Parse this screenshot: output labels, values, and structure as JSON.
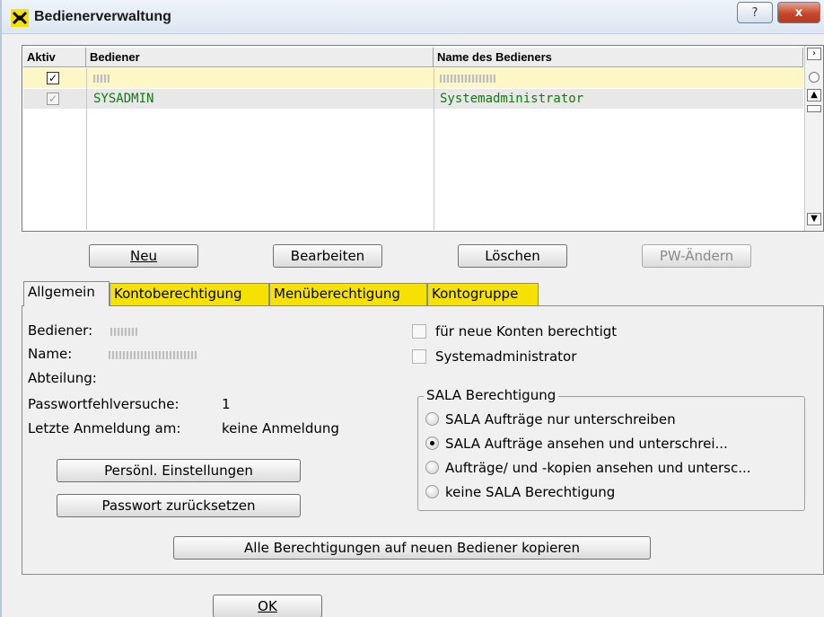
{
  "window": {
    "title": "Bedienerverwaltung",
    "help": "?",
    "close": "x"
  },
  "grid": {
    "columns": [
      "Aktiv",
      "Bediener",
      "Name des Bedieners"
    ],
    "rows": [
      {
        "aktiv": "✓",
        "bediener": "",
        "name": ""
      },
      {
        "aktiv": "✓",
        "bediener": "SYSADMIN",
        "name": "Systemadministrator"
      }
    ]
  },
  "actions": {
    "neu": "Neu",
    "bearbeiten": "Bearbeiten",
    "loeschen": "Löschen",
    "pw_aendern": "PW-Ändern"
  },
  "tabs": [
    "Allgemein",
    "Kontoberechtigung",
    "Menüberechtigung",
    "Kontogruppe"
  ],
  "general": {
    "bediener_label": "Bediener:",
    "name_label": "Name:",
    "abteilung_label": "Abteilung:",
    "passwort_label": "Passwortfehlversuche:",
    "passwort_value": "1",
    "letzte_label": "Letzte Anmeldung am:",
    "letzte_value": "keine Anmeldung",
    "persoenl_button": "Persönl. Einstellungen",
    "passwort_button": "Passwort zurücksetzen",
    "neue_konten": "für neue Konten berechtigt",
    "sysadmin": "Systemadministrator",
    "sala_title": "SALA Berechtigung",
    "sala_options": [
      "SALA Aufträge nur unterschreiben",
      "SALA Aufträge ansehen und unterschrei...",
      "Aufträge/ und -kopien ansehen und untersc...",
      "keine SALA Berechtigung"
    ],
    "sala_selected": 1,
    "copy_button": "Alle Berechtigungen auf neuen Bediener kopieren"
  },
  "footer": {
    "ok": "OK"
  },
  "colors": {
    "tab_yellow": "#f5e200",
    "row_selected": "#fdf7c6",
    "text_green": "#107a10"
  }
}
